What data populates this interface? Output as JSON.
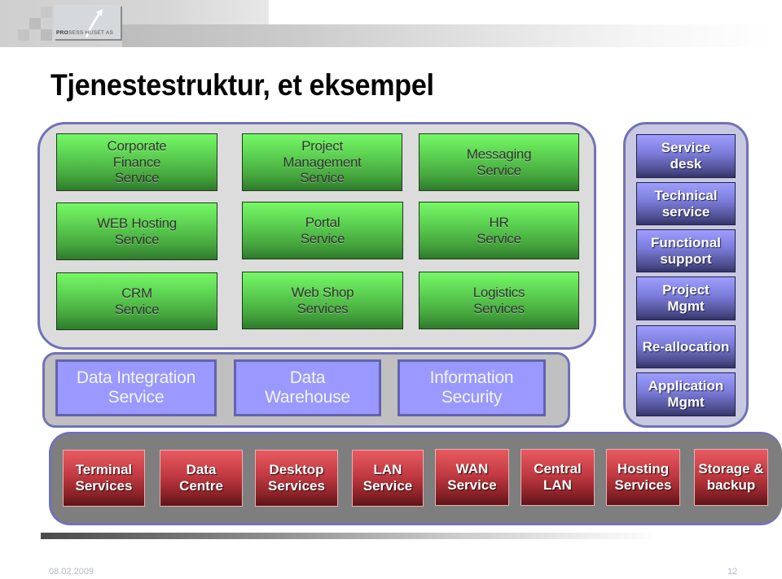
{
  "header": {
    "logo_text_bold": "PRO",
    "logo_text_rest": "SESS HUSET AS"
  },
  "title": "Tjenestestruktur, et eksempel",
  "business_services": [
    "Corporate\nFinance\nService",
    "Project\nManagement\nService",
    "Messaging\nService",
    "WEB Hosting\nService",
    "Portal\nService",
    "HR\nService",
    "CRM\nService",
    "Web Shop\nServices",
    "Logistics\nServices"
  ],
  "information_services": [
    "Data Integration\nService",
    "Data\nWarehouse",
    "Information\nSecurity"
  ],
  "support_services": [
    "Service\ndesk",
    "Technical\nservice",
    "Functional\nsupport",
    "Project\nMgmt",
    "Re-allocation",
    "Application\nMgmt"
  ],
  "infrastructure_services": [
    "Terminal\nServices",
    "Data\nCentre",
    "Desktop\nServices",
    "LAN\nService",
    "WAN\nService",
    "Central\nLAN",
    "Hosting\nServices",
    "Storage &\nbackup"
  ],
  "footer": {
    "date": "08.02.2009",
    "page_number": "12"
  },
  "colors": {
    "container_border": "#7272b8",
    "business_green": "#5ed453",
    "information_blue": "#9999ff",
    "support_purple": "#7a7ad8",
    "infrastructure_red": "#c23a42"
  }
}
